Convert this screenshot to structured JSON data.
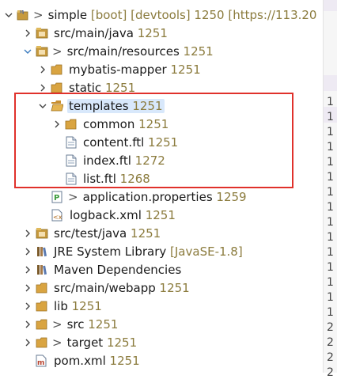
{
  "tree": {
    "project": {
      "name": "simple",
      "suffix": "[boot] [devtools] 1250 [https://113.20"
    },
    "items": [
      {
        "id": "src-main-java",
        "label": "src/main/java",
        "rev": "1251"
      },
      {
        "id": "src-main-resources",
        "label": "src/main/resources",
        "rev": "1251",
        "decor": ">"
      },
      {
        "id": "mybatis-mapper",
        "label": "mybatis-mapper",
        "rev": "1251"
      },
      {
        "id": "static",
        "label": "static",
        "rev": "1251"
      },
      {
        "id": "templates",
        "label": "templates",
        "rev": "1251"
      },
      {
        "id": "common",
        "label": "common",
        "rev": "1251"
      },
      {
        "id": "content-ftl",
        "label": "content.ftl",
        "rev": "1251"
      },
      {
        "id": "index-ftl",
        "label": "index.ftl",
        "rev": "1272"
      },
      {
        "id": "list-ftl",
        "label": "list.ftl",
        "rev": "1268"
      },
      {
        "id": "application-properties",
        "label": "application.properties",
        "rev": "1259",
        "decor": ">"
      },
      {
        "id": "logback-xml",
        "label": "logback.xml",
        "rev": "1251"
      },
      {
        "id": "src-test-java",
        "label": "src/test/java",
        "rev": "1251"
      },
      {
        "id": "jre-library",
        "label": "JRE System Library",
        "extra": "[JavaSE-1.8]"
      },
      {
        "id": "maven-deps",
        "label": "Maven Dependencies"
      },
      {
        "id": "src-main-webapp",
        "label": "src/main/webapp",
        "rev": "1251"
      },
      {
        "id": "lib",
        "label": "lib",
        "rev": "1251"
      },
      {
        "id": "src",
        "label": "src",
        "rev": "1251",
        "decor": ">"
      },
      {
        "id": "target",
        "label": "target",
        "rev": "1251",
        "decor": ">"
      },
      {
        "id": "pom-xml",
        "label": "pom.xml",
        "rev": "1251"
      }
    ]
  },
  "gutter": {
    "line_digits": [
      "1",
      "1",
      "1",
      "1",
      "1",
      "1",
      "1",
      "1",
      "1",
      "1",
      "1",
      "1",
      "1",
      "1",
      "1",
      "2",
      "2",
      "2",
      "2",
      "2",
      "2",
      "2"
    ]
  },
  "colors": {
    "folder": "#d9a441",
    "package": "#c79a3e",
    "annotation": "#e0312b",
    "selection": "#d8e8fb"
  }
}
